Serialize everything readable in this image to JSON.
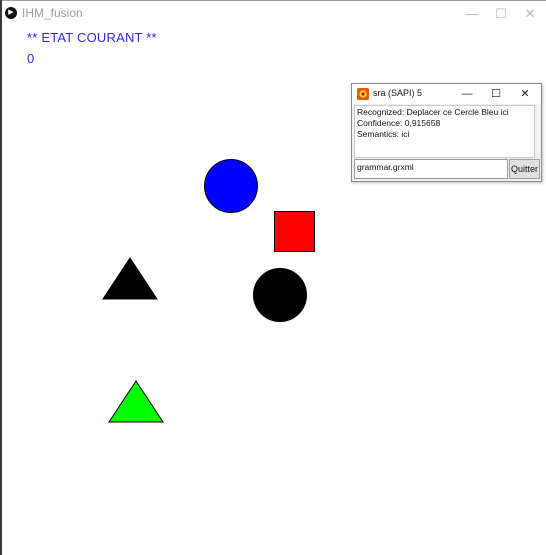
{
  "main_window": {
    "title": "IHM_fusion",
    "icon": "play-circle-icon",
    "controls": {
      "minimize": "—",
      "maximize": "☐",
      "close": "✕"
    }
  },
  "canvas": {
    "state_heading": "** ETAT COURANT **",
    "state_value": "0",
    "shapes": [
      {
        "kind": "circle",
        "color": "#0000ff"
      },
      {
        "kind": "square",
        "color": "#ff0000"
      },
      {
        "kind": "triangle",
        "color": "#000000"
      },
      {
        "kind": "circle",
        "color": "#000000"
      },
      {
        "kind": "triangle",
        "color": "#00ff00"
      }
    ]
  },
  "sapi_window": {
    "title": "sra (SAPI) 5",
    "icon": "sapi-app-icon",
    "controls": {
      "minimize": "—",
      "maximize": "☐",
      "close": "✕"
    },
    "output": {
      "recognized": "Recognized: Deplacer ce Cercle Bleu ici",
      "confidence": "Confidence: 0,915658",
      "semantics": " Semantics: ici"
    },
    "grammar_field": "grammar.grxml",
    "quit_button": "Quitter"
  }
}
